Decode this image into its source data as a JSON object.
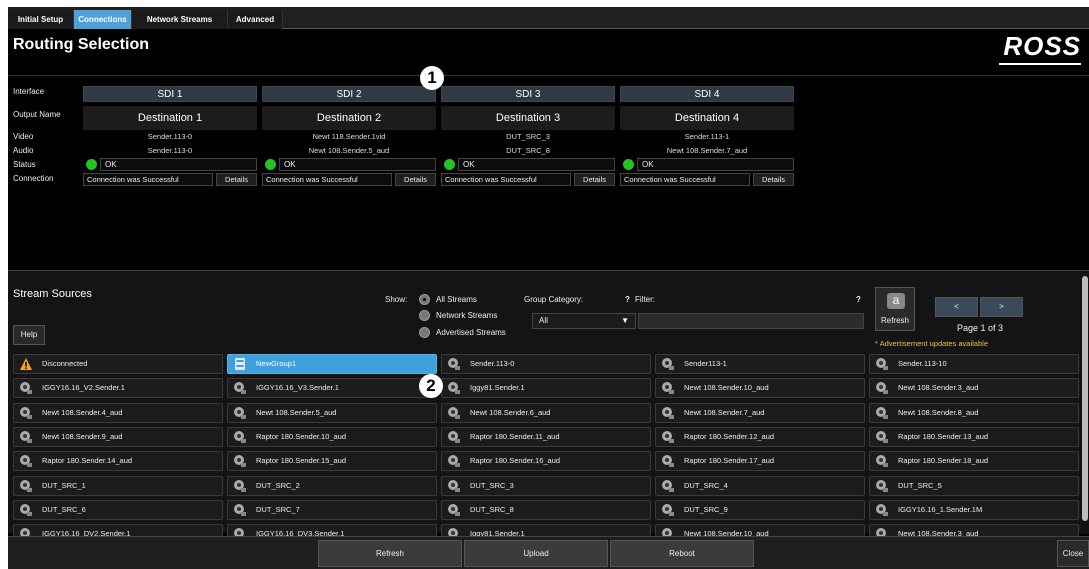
{
  "tabs": [
    "Initial Setup",
    "Connections",
    "Network Streams",
    "Advanced"
  ],
  "active_tab": "Connections",
  "title": "Routing Selection",
  "logo": "ROSS",
  "routing": {
    "labels": {
      "interface": "Interface",
      "output": "Output Name",
      "video": "Video",
      "audio": "Audio",
      "status": "Status",
      "connection": "Connection"
    },
    "columns": [
      {
        "interface": "SDI 1",
        "output": "Destination 1",
        "video": "Sender.113-0",
        "audio": "Sender.113-0",
        "status": "OK",
        "connection": "Connection was Successful",
        "details": "Details"
      },
      {
        "interface": "SDI 2",
        "output": "Destination 2",
        "video": "Newt 118.Sender.1vid",
        "audio": "Newt 108.Sender.5_aud",
        "status": "OK",
        "connection": "Connection was Successful",
        "details": "Details"
      },
      {
        "interface": "SDI 3",
        "output": "Destination 3",
        "video": "DUT_SRC_3",
        "audio": "DUT_SRC_8",
        "status": "OK",
        "connection": "Connection was Successful",
        "details": "Details"
      },
      {
        "interface": "SDI 4",
        "output": "Destination 4",
        "video": "Sender.113-1",
        "audio": "Newt 108.Sender.7_aud",
        "status": "OK",
        "connection": "Connection was Successful",
        "details": "Details"
      }
    ],
    "status_color": "#22c322"
  },
  "callouts": [
    "1",
    "2"
  ],
  "sources": {
    "title": "Stream Sources",
    "help": "Help",
    "show_label": "Show:",
    "options": [
      "All Streams",
      "Network Streams",
      "Advertised Streams"
    ],
    "selected_option": "All Streams",
    "group_label": "Group Category:",
    "group_value": "All",
    "question": "?",
    "filter_label": "Filter:",
    "filter_value": "",
    "filter_help": "?",
    "refresh": "Refresh",
    "prev": "<",
    "next": ">",
    "page": "Page 1 of 3",
    "notice": "* Advertisement updates available",
    "tiles": [
      [
        "Disconnected",
        "NewGroup1",
        "Sender.113-0",
        "Sender113-1",
        "Sender.113-10"
      ],
      [
        "IGGY16.16_V2.Sender.1",
        "IGGY16.16_V3.Sender.1",
        "Iggy81.Sender.1",
        "Newt 108.Sender.10_aud",
        "Newt 108.Sender.3_aud"
      ],
      [
        "Newt 108.Sender.4_aud",
        "Newt 108.Sender.5_aud",
        "Newt 108.Sender.6_aud",
        "Newt 108.Sender.7_aud",
        "Newt 108.Sender.8_aud"
      ],
      [
        "Newt 108.Sender.9_aud",
        "Raptor 180.Sender.10_aud",
        "Raptor 180.Sender.11_aud",
        "Raptor 180.Sender.12_aud",
        "Raptor 180.Sender.13_aud"
      ],
      [
        "Raptor 180.Sender.14_aud",
        "Raptor 180.Sender.15_aud",
        "Raptor 180.Sender.16_aud",
        "Raptor 180.Sender.17_aud",
        "Raptor 180.Sender.18_aud"
      ],
      [
        "DUT_SRC_1",
        "DUT_SRC_2",
        "DUT_SRC_3",
        "DUT_SRC_4",
        "DUT_SRC_5"
      ],
      [
        "DUT_SRC_6",
        "DUT_SRC_7",
        "DUT_SRC_8",
        "DUT_SRC_9",
        "IGGY16.16_1.Sender.1M"
      ],
      [
        "IGGY16.16_DV2.Sender.1",
        "IGGY16.16_DV3.Sender.1",
        "Iggy81.Sender.1",
        "Newt 108.Sender.10_aud",
        "Newt 108.Sender.3_aud"
      ]
    ],
    "tile_icons": {
      "Disconnected": "warning-icon",
      "NewGroup1": "group-icon",
      "default": "stream-icon"
    },
    "selected_tile": "NewGroup1",
    "accent": "#3fa0dc",
    "warning_color": "#f5a623"
  },
  "bottom": {
    "refresh": "Refresh",
    "upload": "Upload",
    "reboot": "Reboot",
    "close": "Close"
  }
}
